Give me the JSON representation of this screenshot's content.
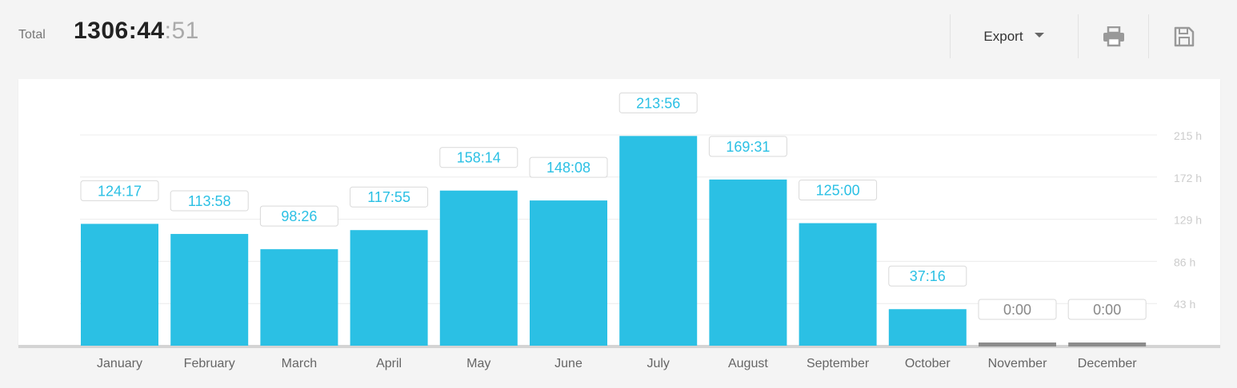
{
  "header": {
    "total_label": "Total",
    "total_hm": "1306:44",
    "total_sec": ":51",
    "export_label": "Export",
    "print_icon": "printer-icon",
    "save_icon": "save-icon"
  },
  "colors": {
    "bar": "#2bc0e4",
    "bar_zero": "#8c8c8c",
    "label_text": "#2bc0e4",
    "label_zero_text": "#888888",
    "grid": "#ececec",
    "axis_text": "#666666",
    "tick_text": "#cccccc",
    "baseline": "#d4d4d4"
  },
  "chart_data": {
    "type": "bar",
    "categories": [
      "January",
      "February",
      "March",
      "April",
      "May",
      "June",
      "July",
      "August",
      "September",
      "October",
      "November",
      "December"
    ],
    "values": [
      124.28,
      113.97,
      98.43,
      117.92,
      158.23,
      148.13,
      213.93,
      169.52,
      125.0,
      37.27,
      0,
      0
    ],
    "data_labels": [
      "124:17",
      "113:58",
      "98:26",
      "117:55",
      "158:14",
      "148:08",
      "213:56",
      "169:31",
      "125:00",
      "37:16",
      "0:00",
      "0:00"
    ],
    "y_ticks": [
      43,
      86,
      129,
      172,
      215
    ],
    "y_tick_labels": [
      "43 h",
      "86 h",
      "129 h",
      "172 h",
      "215 h"
    ],
    "ylim": [
      0,
      215
    ],
    "grid": true,
    "y_axis_position": "right",
    "title": "",
    "xlabel": "",
    "ylabel": ""
  }
}
